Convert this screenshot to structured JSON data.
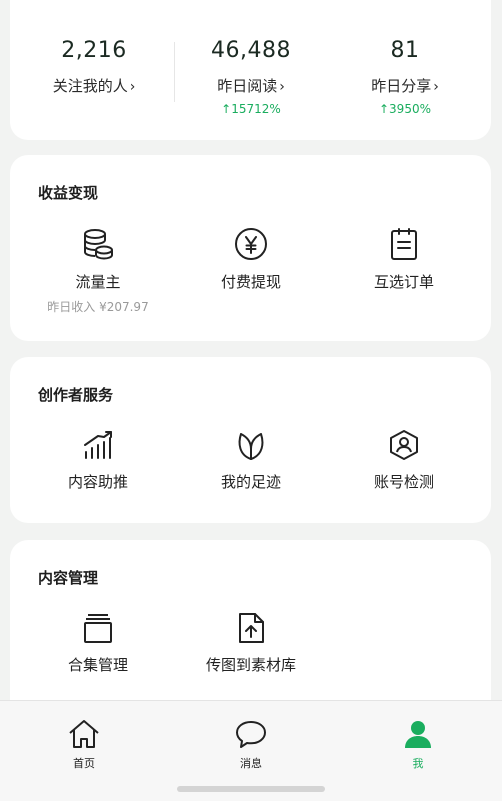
{
  "stats": [
    {
      "value": "2,216",
      "label": "关注我的人",
      "delta": ""
    },
    {
      "value": "46,488",
      "label": "昨日阅读",
      "delta": "15712%"
    },
    {
      "value": "81",
      "label": "昨日分享",
      "delta": "3950%"
    }
  ],
  "income": {
    "title": "收益变现",
    "items": [
      {
        "label": "流量主",
        "sub": "昨日收入 ¥207.97",
        "icon": "coins-icon"
      },
      {
        "label": "付费提现",
        "sub": "",
        "icon": "yen-icon"
      },
      {
        "label": "互选订单",
        "sub": "",
        "icon": "order-icon"
      }
    ]
  },
  "creator": {
    "title": "创作者服务",
    "items": [
      {
        "label": "内容助推",
        "icon": "growth-chart-icon"
      },
      {
        "label": "我的足迹",
        "icon": "leaf-icon"
      },
      {
        "label": "账号检测",
        "icon": "account-check-icon"
      }
    ]
  },
  "content": {
    "title": "内容管理",
    "items": [
      {
        "label": "合集管理",
        "icon": "collection-icon"
      },
      {
        "label": "传图到素材库",
        "icon": "upload-file-icon"
      }
    ]
  },
  "nav": [
    {
      "label": "首页",
      "icon": "home-icon"
    },
    {
      "label": "消息",
      "icon": "message-icon"
    },
    {
      "label": "我",
      "icon": "person-icon"
    }
  ],
  "colors": {
    "accent": "#1aad5e",
    "background": "#f2f3f2",
    "card": "#ffffff"
  },
  "chevron": "›",
  "up_arrow": "↑"
}
